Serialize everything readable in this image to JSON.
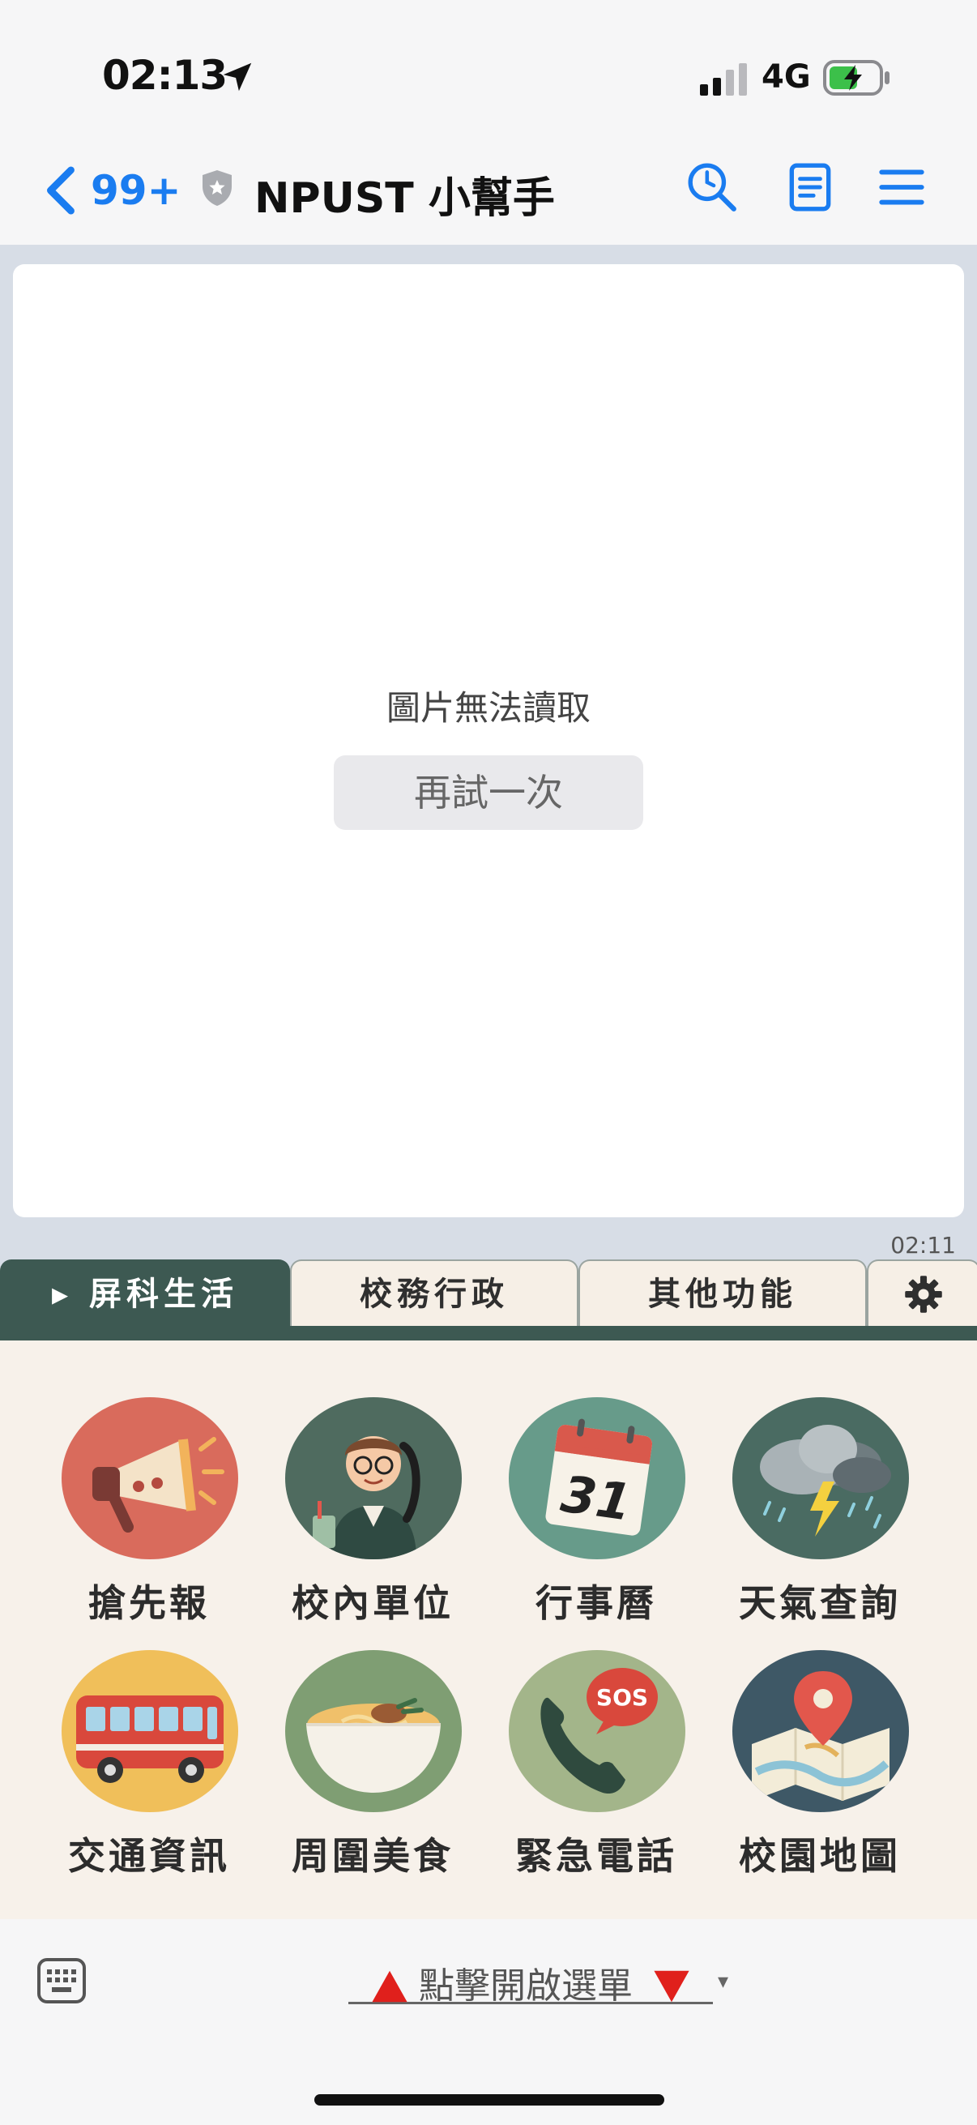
{
  "status_bar": {
    "time": "02:13",
    "network": "4G"
  },
  "header": {
    "back_count": "99+",
    "title": "NPUST 小幫手"
  },
  "chat": {
    "error_text": "圖片無法讀取",
    "retry_label": "再試一次",
    "message_time": "02:11"
  },
  "rich_menu": {
    "tabs": [
      {
        "label": "▸ 屏科生活",
        "active": true
      },
      {
        "label": "校務行政",
        "active": false
      },
      {
        "label": "其他功能",
        "active": false
      }
    ],
    "items": [
      {
        "label": "搶先報",
        "icon": "megaphone-icon"
      },
      {
        "label": "校內單位",
        "icon": "staff-phone-icon"
      },
      {
        "label": "行事曆",
        "icon": "calendar-icon",
        "calendar_day": "31"
      },
      {
        "label": "天氣查詢",
        "icon": "storm-cloud-icon"
      },
      {
        "label": "交通資訊",
        "icon": "bus-icon"
      },
      {
        "label": "周圍美食",
        "icon": "noodle-bowl-icon"
      },
      {
        "label": "緊急電話",
        "icon": "sos-phone-icon",
        "badge": "SOS"
      },
      {
        "label": "校園地圖",
        "icon": "map-pin-icon"
      }
    ]
  },
  "bottom_bar": {
    "menu_toggle_label": "點擊開啟選單",
    "caret": "▾"
  },
  "colors": {
    "accent_blue": "#1a7cf0",
    "tab_active": "#3d5952",
    "chat_bg": "#d7dde6",
    "menu_bg": "#f7f1ea"
  }
}
